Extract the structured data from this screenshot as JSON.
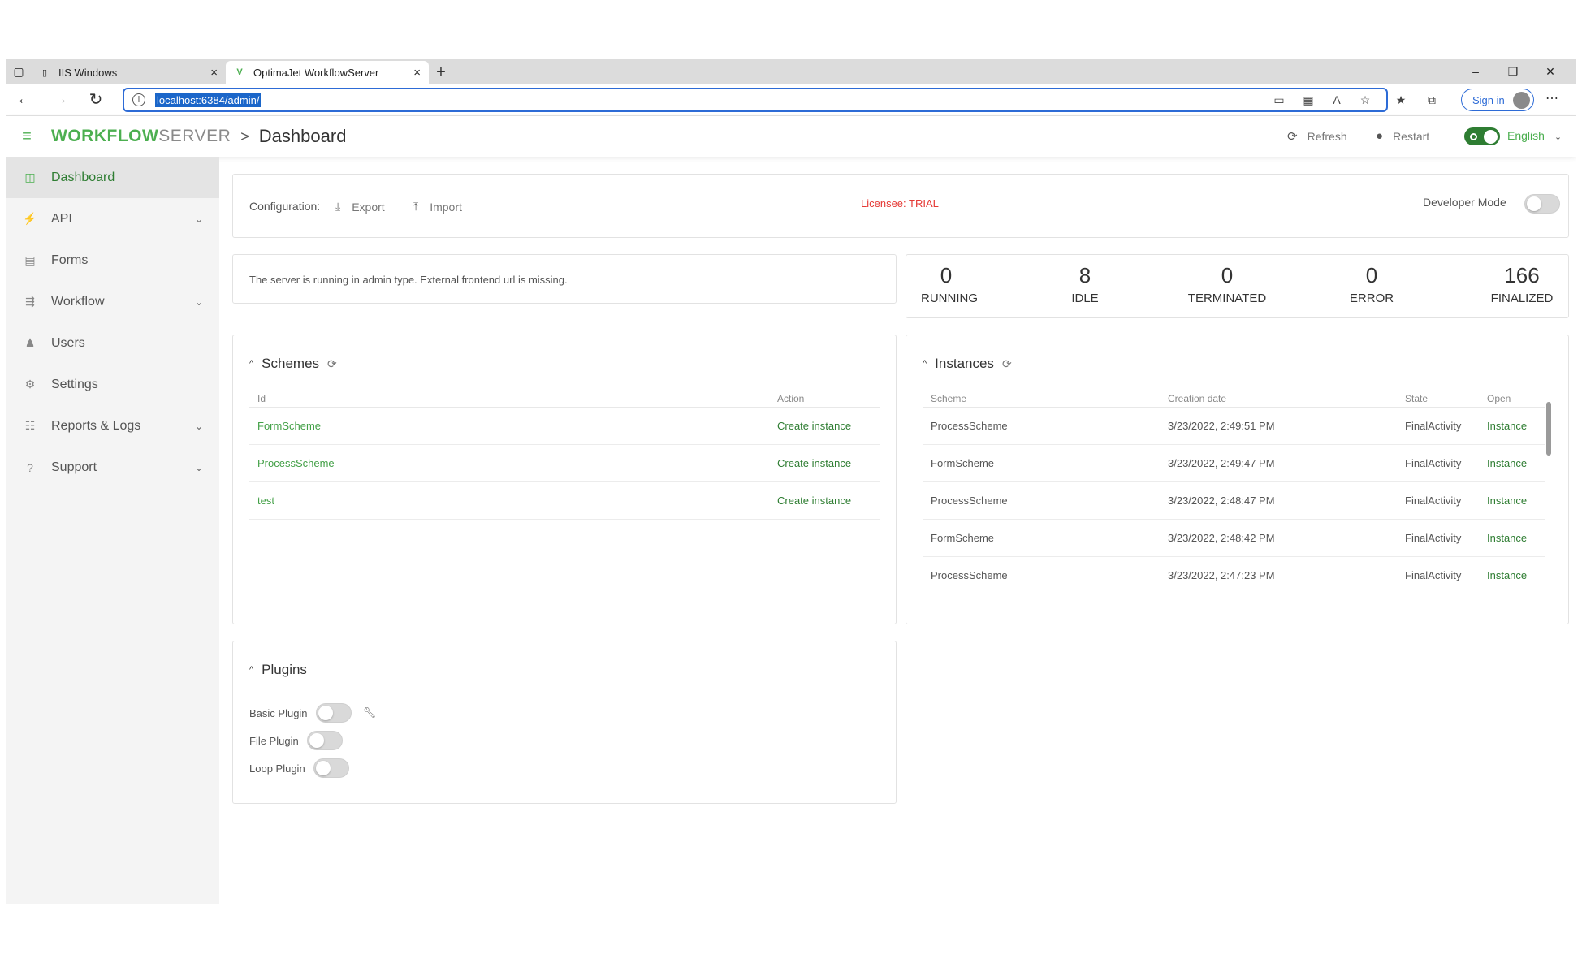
{
  "browser": {
    "tabs": [
      {
        "label": "IIS Windows",
        "active": false
      },
      {
        "label": "OptimaJet WorkflowServer",
        "active": true
      }
    ],
    "new_tab": "+",
    "url": "localhost:6384/admin/",
    "sign_in": "Sign in"
  },
  "header": {
    "logo_primary": "WORKFLOW",
    "logo_secondary": "SERVER",
    "breadcrumb_separator": ">",
    "page_title": "Dashboard",
    "refresh": "Refresh",
    "restart": "Restart",
    "language": "English"
  },
  "sidebar": {
    "items": [
      {
        "label": "Dashboard",
        "icon": "dashboard-icon",
        "active": true,
        "expandable": false
      },
      {
        "label": "API",
        "icon": "plug-icon",
        "active": false,
        "expandable": true
      },
      {
        "label": "Forms",
        "icon": "form-icon",
        "active": false,
        "expandable": false
      },
      {
        "label": "Workflow",
        "icon": "workflow-icon",
        "active": false,
        "expandable": true
      },
      {
        "label": "Users",
        "icon": "users-icon",
        "active": false,
        "expandable": false
      },
      {
        "label": "Settings",
        "icon": "gear-icon",
        "active": false,
        "expandable": false
      },
      {
        "label": "Reports & Logs",
        "icon": "reports-icon",
        "active": false,
        "expandable": true
      },
      {
        "label": "Support",
        "icon": "help-icon",
        "active": false,
        "expandable": true
      }
    ]
  },
  "config": {
    "label": "Configuration:",
    "export": "Export",
    "import": "Import",
    "licensee": "Licensee: TRIAL",
    "developer_mode": "Developer Mode",
    "developer_mode_on": false
  },
  "notice": "The server is running in admin type. External frontend url is missing.",
  "stats": [
    {
      "value": "0",
      "label": "RUNNING"
    },
    {
      "value": "8",
      "label": "IDLE"
    },
    {
      "value": "0",
      "label": "TERMINATED"
    },
    {
      "value": "0",
      "label": "ERROR"
    },
    {
      "value": "166",
      "label": "FINALIZED"
    }
  ],
  "schemes": {
    "title": "Schemes",
    "columns": [
      "Id",
      "Action"
    ],
    "rows": [
      {
        "id": "FormScheme",
        "action": "Create instance"
      },
      {
        "id": "ProcessScheme",
        "action": "Create instance"
      },
      {
        "id": "test",
        "action": "Create instance"
      }
    ]
  },
  "instances": {
    "title": "Instances",
    "columns": [
      "Scheme",
      "Creation date",
      "State",
      "Open"
    ],
    "rows": [
      {
        "scheme": "ProcessScheme",
        "date": "3/23/2022, 2:49:51 PM",
        "state": "FinalActivity",
        "open": "Instance"
      },
      {
        "scheme": "FormScheme",
        "date": "3/23/2022, 2:49:47 PM",
        "state": "FinalActivity",
        "open": "Instance"
      },
      {
        "scheme": "ProcessScheme",
        "date": "3/23/2022, 2:48:47 PM",
        "state": "FinalActivity",
        "open": "Instance"
      },
      {
        "scheme": "FormScheme",
        "date": "3/23/2022, 2:48:42 PM",
        "state": "FinalActivity",
        "open": "Instance"
      },
      {
        "scheme": "ProcessScheme",
        "date": "3/23/2022, 2:47:23 PM",
        "state": "FinalActivity",
        "open": "Instance"
      }
    ]
  },
  "plugins": {
    "title": "Plugins",
    "items": [
      {
        "name": "Basic Plugin",
        "enabled": false,
        "has_settings": true
      },
      {
        "name": "File Plugin",
        "enabled": false,
        "has_settings": false
      },
      {
        "name": "Loop Plugin",
        "enabled": false,
        "has_settings": false
      }
    ]
  },
  "colors": {
    "accent": "#4caf50",
    "accent_dark": "#2e7d32",
    "licensee": "#e53935",
    "url_highlight": "#1b66c9"
  }
}
